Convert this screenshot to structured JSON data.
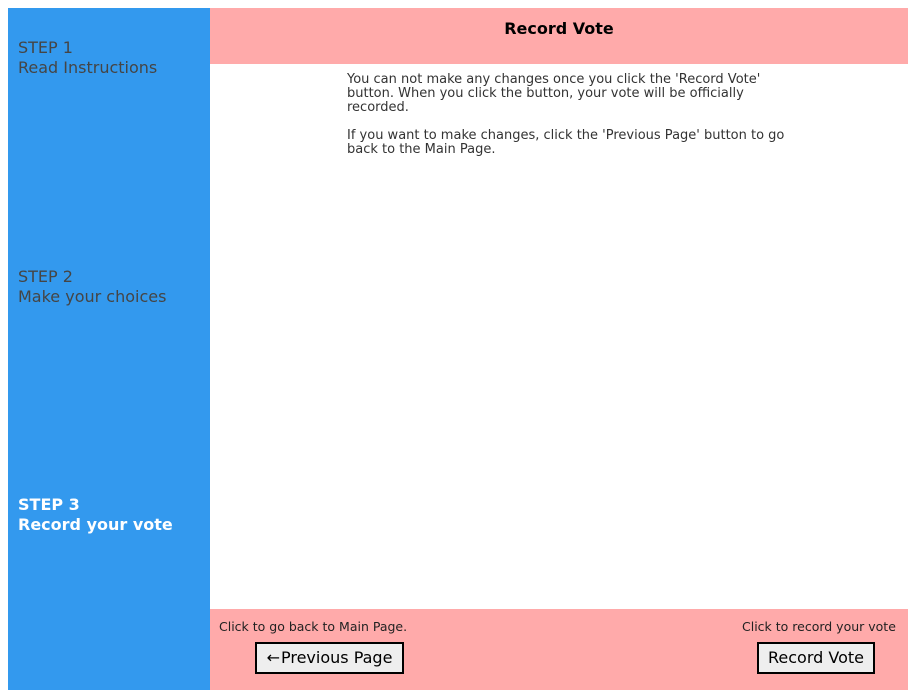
{
  "sidebar": {
    "steps": [
      {
        "number": "STEP 1",
        "label": "Read Instructions"
      },
      {
        "number": "STEP 2",
        "label": "Make your choices"
      },
      {
        "number": "STEP 3",
        "label": "Record your vote"
      }
    ]
  },
  "header": {
    "title": "Record Vote"
  },
  "main": {
    "paragraphs": [
      "You can not make any changes once you click the 'Record Vote' button. When you click the button, your vote will be officially recorded.",
      "If you want to make changes, click the 'Previous Page' button to go back to the Main Page."
    ]
  },
  "footer": {
    "back_hint": "Click to go back to Main Page.",
    "record_hint": "Click to record your vote",
    "prev_arrow": "←",
    "prev_label": "Previous Page",
    "record_label": "Record Vote"
  },
  "colors": {
    "sidebar": "#3399ee",
    "header_footer": "#ffaaaa",
    "active_step_text": "#ffffff",
    "inactive_step_text": "#454545"
  }
}
